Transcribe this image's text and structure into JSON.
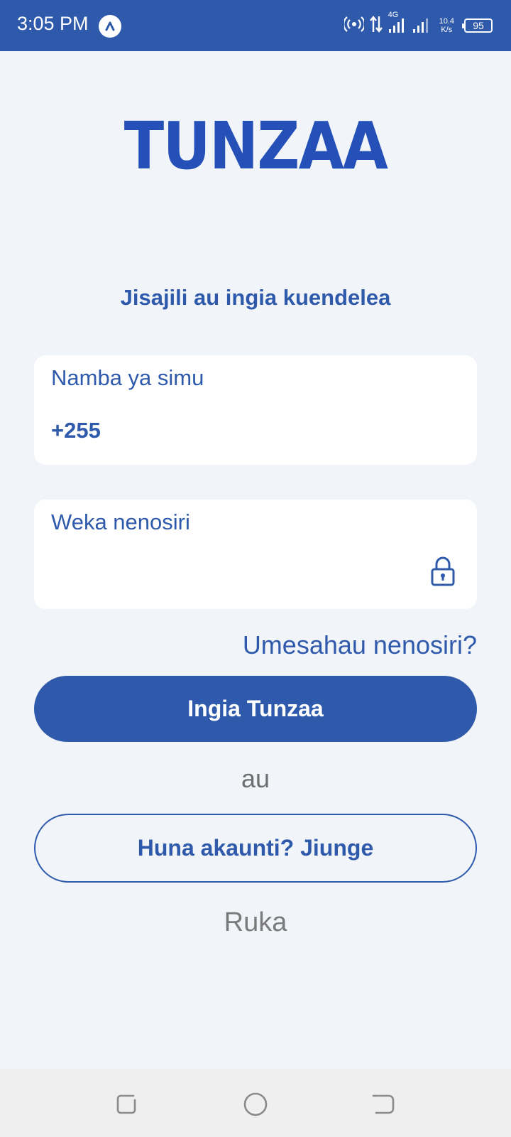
{
  "status_bar": {
    "time": "3:05 PM",
    "network_type": "4G",
    "net_speed_value": "10.4",
    "net_speed_unit": "K/s",
    "battery": "95"
  },
  "brand": {
    "logo_text": "TUNZAA",
    "accent_color": "#2f5aab"
  },
  "login": {
    "subtitle": "Jisajili au ingia kuendelea",
    "phone_label": "Namba ya simu",
    "phone_value": "+255",
    "password_label": "Weka nenosiri",
    "forgot_password": "Umesahau nenosiri?",
    "login_button": "Ingia Tunzaa",
    "or_text": "au",
    "signup_button": "Huna akaunti? Jiunge",
    "skip": "Ruka"
  }
}
